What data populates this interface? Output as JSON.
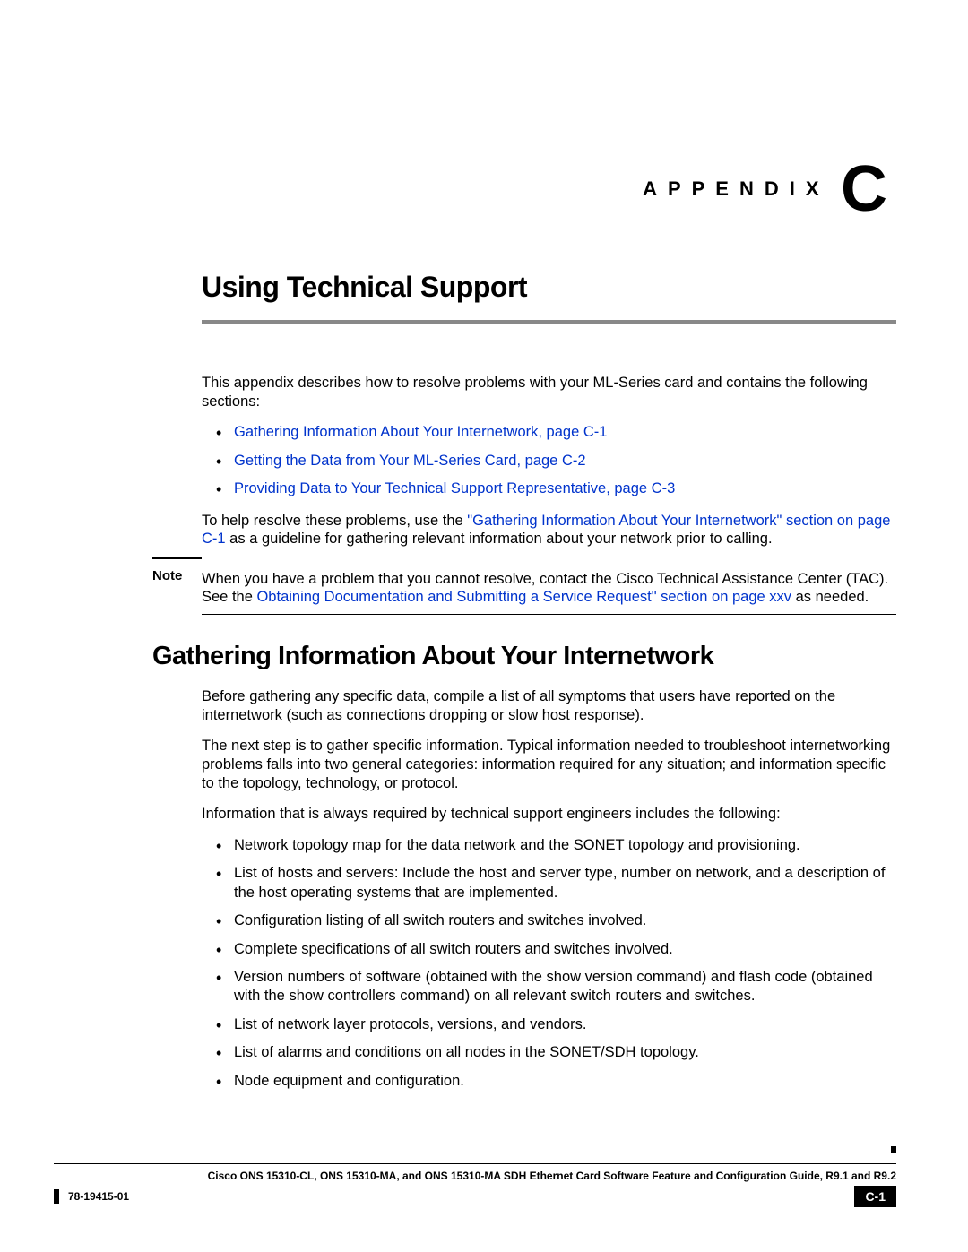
{
  "appendix": {
    "label": "APPENDIX",
    "letter": "C"
  },
  "chapterTitle": "Using Technical Support",
  "intro": "This appendix describes how to resolve problems with your ML-Series card and contains the following sections:",
  "introLinks": [
    "Gathering Information About Your Internetwork, page C-1",
    "Getting the Data from Your ML-Series Card, page C-2",
    "Providing Data to Your Technical Support Representative, page C-3"
  ],
  "helpPara": {
    "pre": "To help resolve these problems, use the ",
    "link": "\"Gathering Information About Your Internetwork\" section on page C-1",
    "post": " as a guideline for gathering relevant information about your network prior to calling."
  },
  "note": {
    "label": "Note",
    "textPre": "When you have a problem that you cannot resolve, contact the Cisco Technical Assistance Center (TAC). See the ",
    "link": "Obtaining Documentation and Submitting a Service Request\" section on page xxv",
    "textPost": " as needed."
  },
  "section": {
    "title": "Gathering Information About Your Internetwork",
    "p1": "Before gathering any specific data, compile a list of all symptoms that users have reported on the internetwork (such as connections dropping or slow host response).",
    "p2": "The next step is to gather specific information. Typical information needed to troubleshoot internetworking problems falls into two general categories: information required for any situation; and information specific to the topology, technology, or protocol.",
    "p3": "Information that is always required by technical support engineers includes the following:",
    "bullets": [
      "Network topology map for the data network and the SONET topology and provisioning.",
      "List of hosts and servers: Include the host and server type, number on network, and a description of the host operating systems that are implemented.",
      "Configuration listing of all switch routers and switches involved.",
      "Complete specifications of all switch routers and switches involved.",
      "Version numbers of software (obtained with the show version command) and flash code (obtained with the show controllers command) on all relevant switch routers and switches.",
      "List of network layer protocols, versions, and vendors.",
      "List of alarms and conditions on all nodes in the SONET/SDH topology.",
      "Node equipment and configuration."
    ]
  },
  "footer": {
    "title": "Cisco ONS 15310-CL, ONS 15310-MA, and ONS 15310-MA SDH Ethernet Card Software Feature and Configuration Guide, R9.1 and R9.2",
    "docId": "78-19415-01",
    "pageNum": "C-1"
  }
}
